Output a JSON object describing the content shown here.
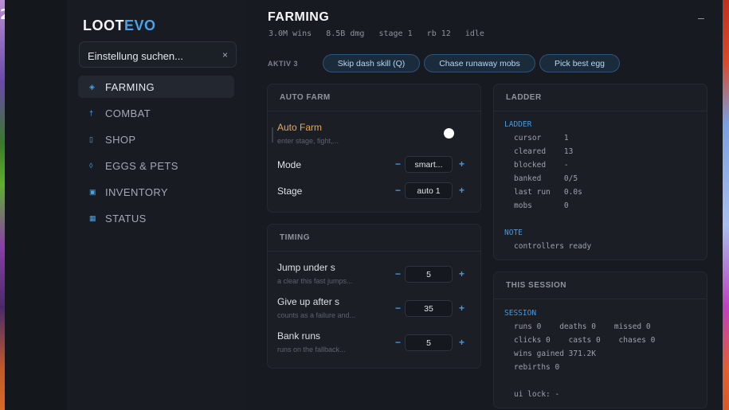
{
  "game_overlay_corner": "2",
  "sidebar": {
    "logo_main": "LOOT",
    "logo_accent": "EVO",
    "search_placeholder": "Einstellung suchen...",
    "search_clear": "×",
    "items": [
      {
        "label": "FARMING",
        "icon": "◈",
        "active": true
      },
      {
        "label": "COMBAT",
        "icon": "†"
      },
      {
        "label": "SHOP",
        "icon": "▯"
      },
      {
        "label": "EGGS & PETS",
        "icon": "◊"
      },
      {
        "label": "INVENTORY",
        "icon": "▣"
      },
      {
        "label": "STATUS",
        "icon": "▦"
      }
    ]
  },
  "header": {
    "title": "FARMING",
    "stats": "3.0M wins   8.5B dmg   stage 1   rb 12   idle",
    "minimize": "–"
  },
  "active": {
    "label": "AKTIV 3",
    "pills": [
      "Skip dash skill (Q)",
      "Chase runaway mobs",
      "Pick best egg"
    ]
  },
  "autofarm": {
    "heading": "AUTO FARM",
    "toggle_label": "Auto Farm",
    "toggle_hint": "enter stage, fight,...",
    "toggle_on": false,
    "mode_label": "Mode",
    "mode_value": "smart...",
    "stage_label": "Stage",
    "stage_value": "auto 1",
    "minus": "−",
    "plus": "+"
  },
  "timing": {
    "heading": "TIMING",
    "rows": [
      {
        "label": "Jump under s",
        "hint": "a clear this fast jumps...",
        "value": "5"
      },
      {
        "label": "Give up after s",
        "hint": "counts as a failure and...",
        "value": "35"
      },
      {
        "label": "Bank runs",
        "hint": "runs on the fallback...",
        "value": "5"
      }
    ]
  },
  "ladder": {
    "heading": "LADDER",
    "section": "LADDER",
    "rows": [
      "cursor     1",
      "cleared    13",
      "blocked    -",
      "banked     0/5",
      "last run   0.0s",
      "mobs       0"
    ],
    "note_label": "NOTE",
    "note_text": "controllers ready"
  },
  "session": {
    "heading": "THIS SESSION",
    "section": "SESSION",
    "rows": [
      "runs 0    deaths 0    missed 0",
      "clicks 0    casts 0    chases 0",
      "wins gained 371.2K",
      "rebirths 0",
      "",
      "ui lock: -"
    ]
  },
  "colors": {
    "accent": "#4aa3ea",
    "autofarm_label": "#e6a85a",
    "panel": "#171a20"
  }
}
